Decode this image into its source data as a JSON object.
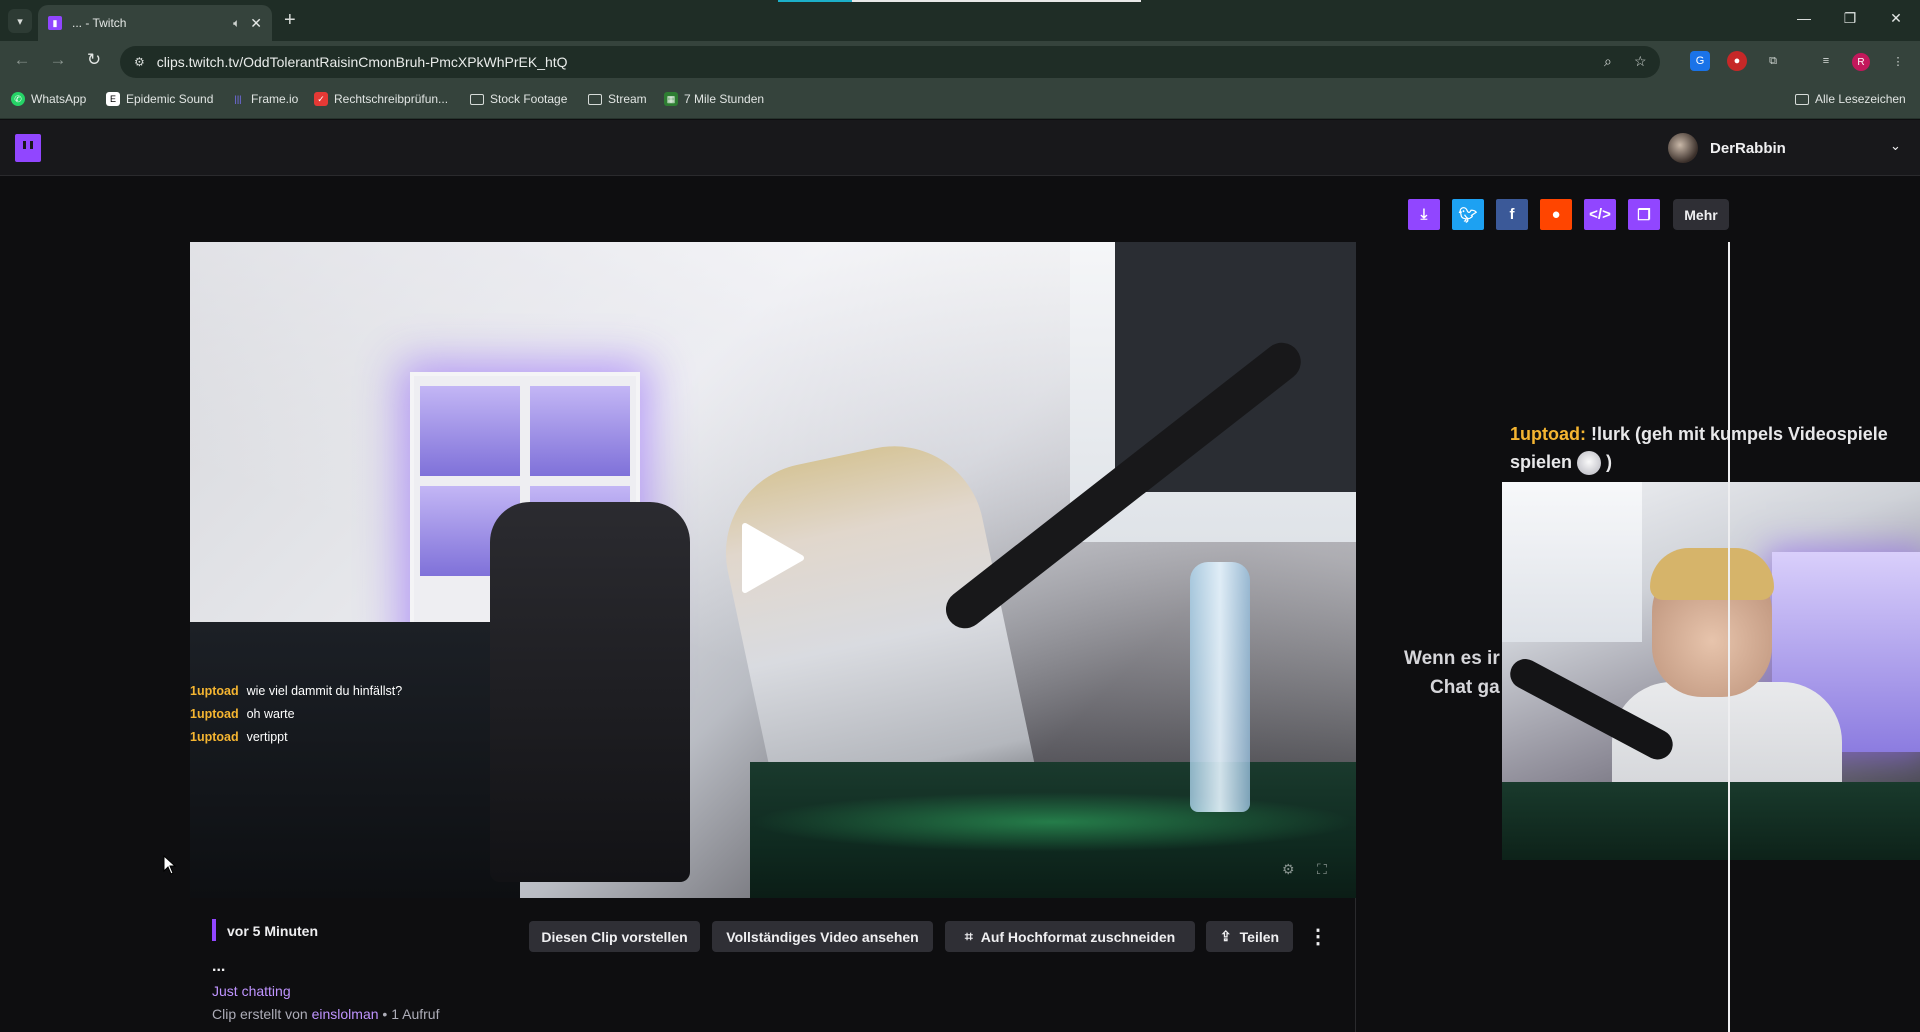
{
  "browser": {
    "tab": {
      "title": "... - Twitch"
    },
    "address": {
      "url": "clips.twitch.tv/OddTolerantRaisinCmonBruh-PmcXPkWhPrEK_htQ"
    },
    "bookmarks": [
      {
        "label": "WhatsApp",
        "color": "#25d366"
      },
      {
        "label": "Epidemic Sound",
        "color": "#ffffff"
      },
      {
        "label": "Frame.io",
        "color": "#5b53ff"
      },
      {
        "label": "Rechtschreibprüfun...",
        "color": "#e53935"
      },
      {
        "label": "Stock Footage"
      },
      {
        "label": "Stream"
      },
      {
        "label": "7 Mile Stunden",
        "color": "#2e7d32"
      }
    ],
    "all_bookmarks_label": "Alle Lesezeichen",
    "profile_initial": "R"
  },
  "twitch": {
    "username": "DerRabbin",
    "share": {
      "more_label": "Mehr"
    },
    "video_chat": [
      {
        "name": "1uptoad",
        "msg": "wie viel dammit du hinfällst?"
      },
      {
        "name": "1uptoad",
        "msg": "oh warte"
      },
      {
        "name": "1uptoad",
        "msg": "vertippt"
      }
    ],
    "overlay": {
      "chat_name": "1uptoad",
      "chat_sep": ":",
      "chat_msg_a": " !lurk (geh mit kumpels Videospiele",
      "chat_msg_b": "spielen",
      "chat_msg_c": " )",
      "text_line1": "Wenn es ir",
      "text_line2": "Chat ga"
    },
    "clip": {
      "timestamp": "vor 5 Minuten",
      "buttons": {
        "present": "Diesen Clip vorstellen",
        "full_video": "Vollständiges Video ansehen",
        "crop": "Auf Hochformat zuschneiden",
        "share": "Teilen"
      },
      "ellipsis": "...",
      "category": "Just chatting",
      "credit_prefix": "Clip erstellt von ",
      "creator": "einslolman",
      "views": " • 1 Aufruf"
    }
  }
}
